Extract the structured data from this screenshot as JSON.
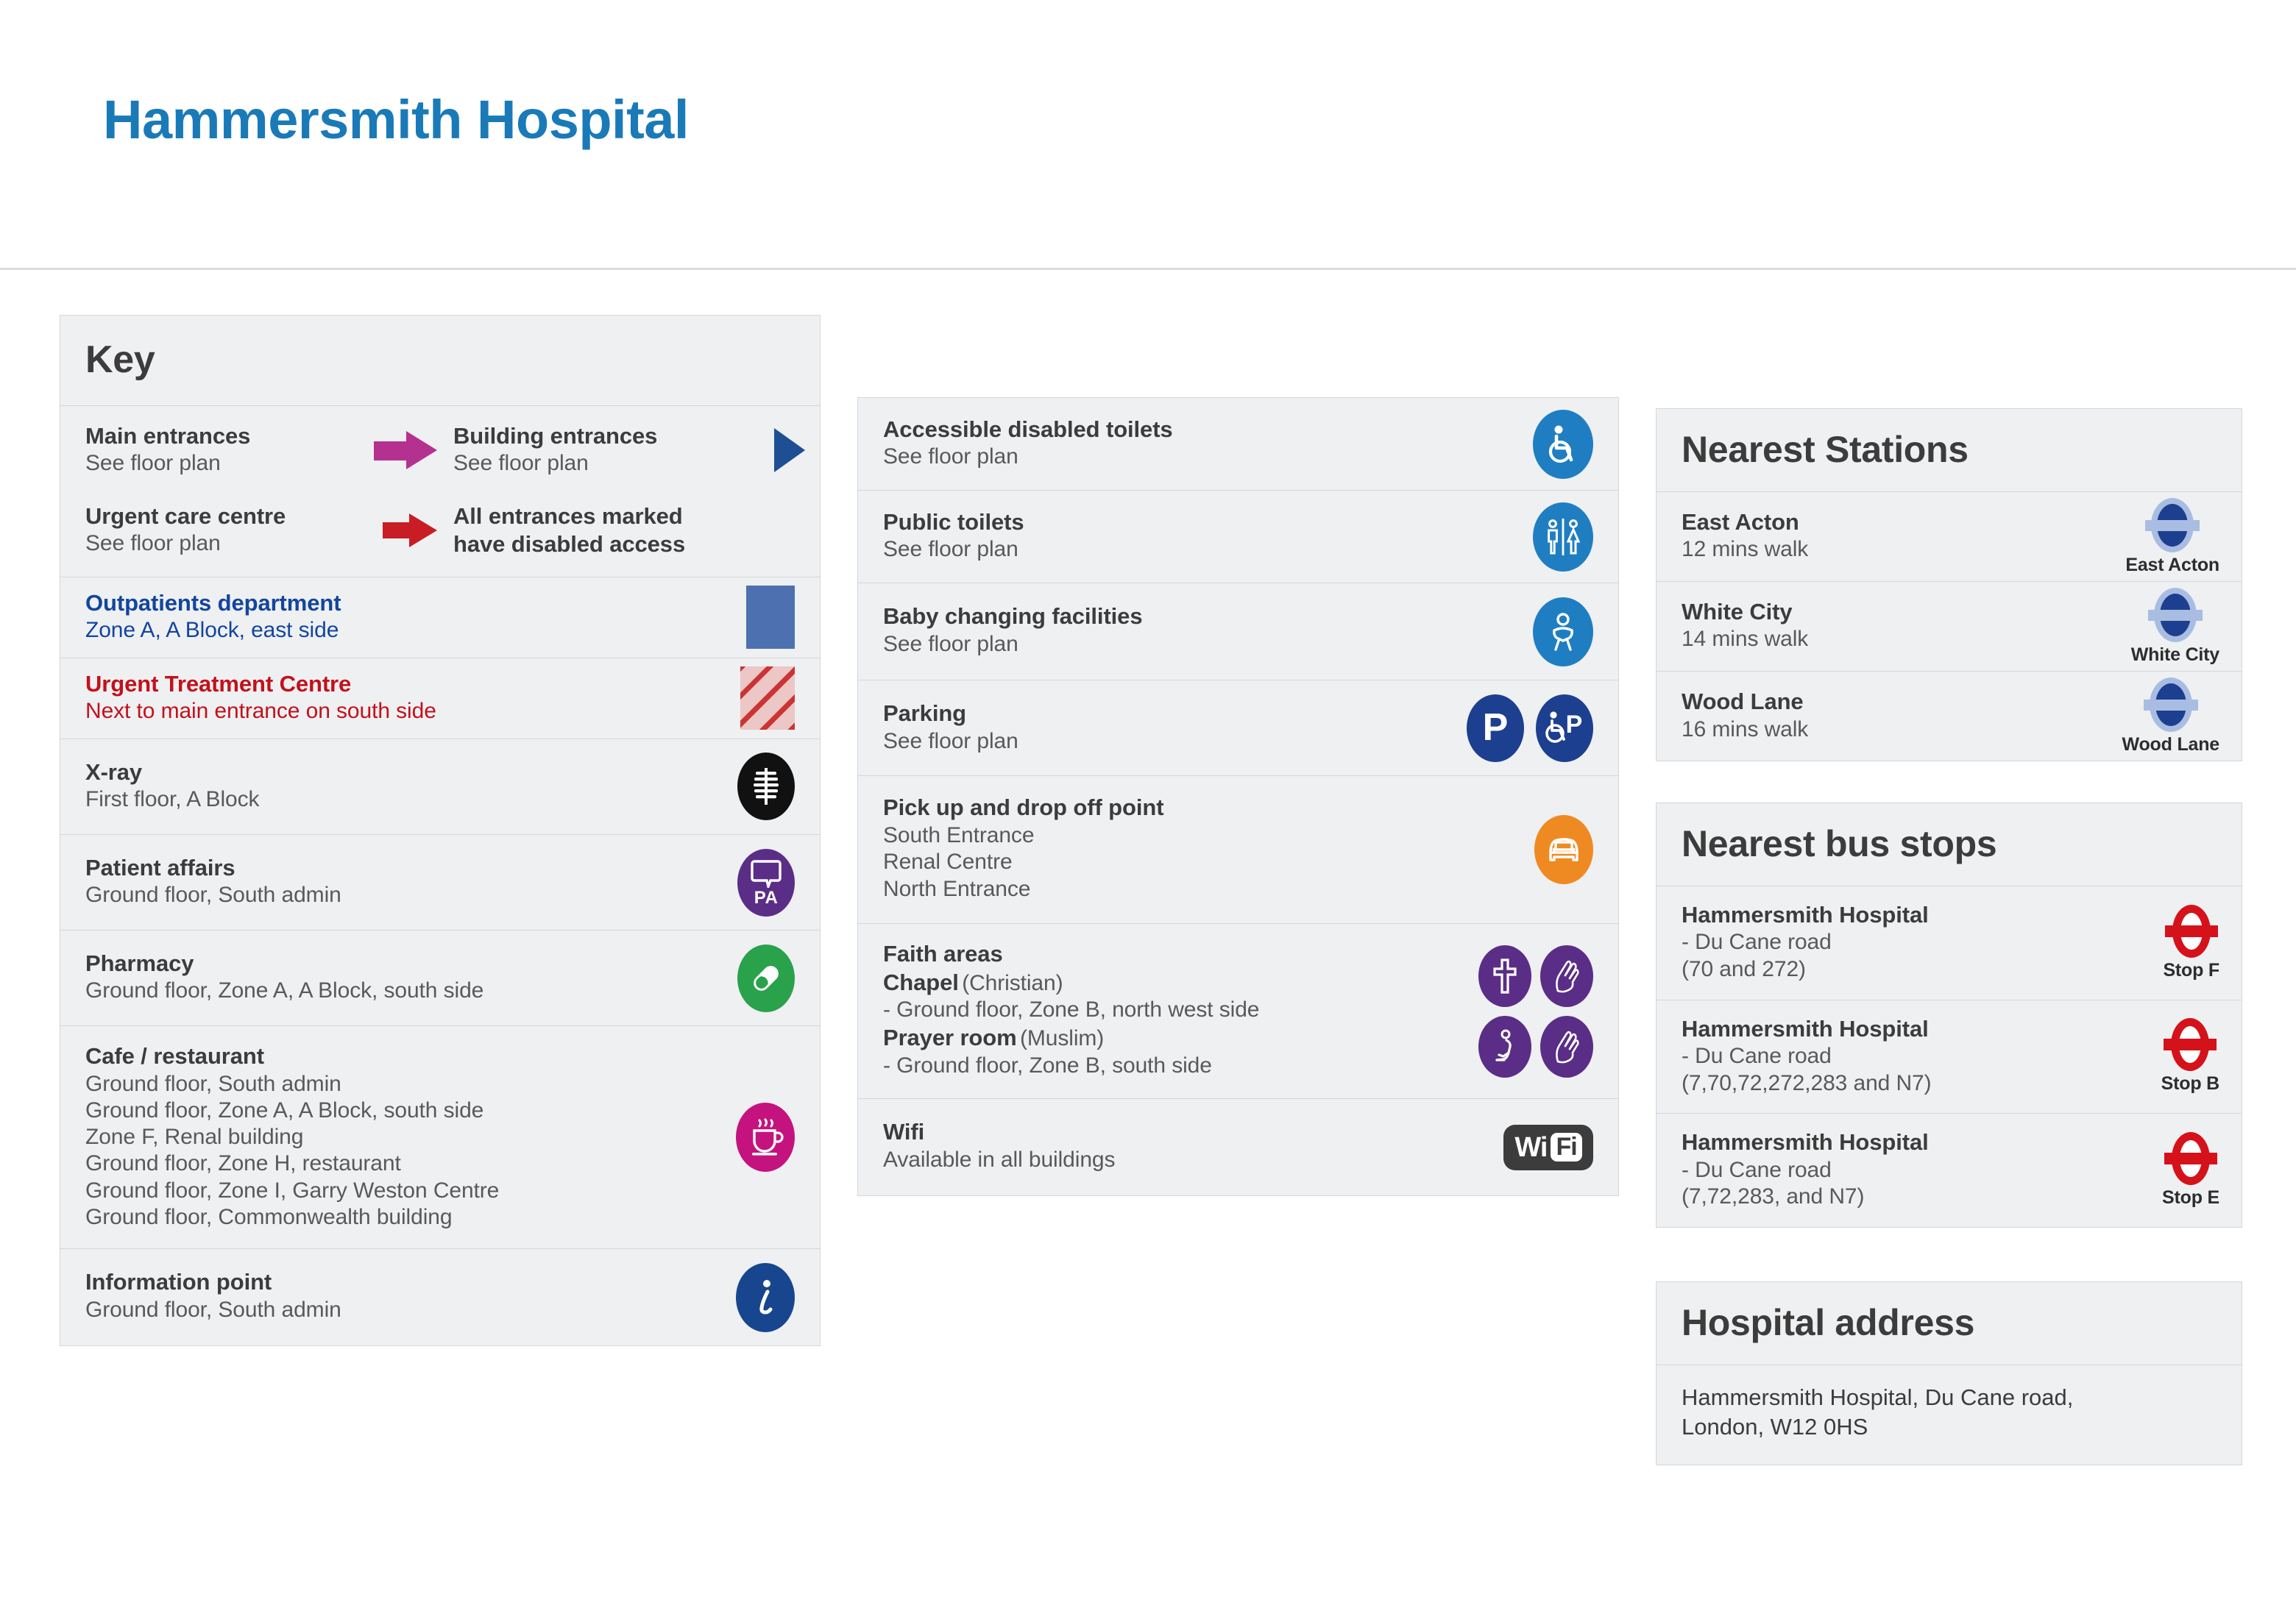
{
  "header": {
    "title": "Hammersmith Hospital"
  },
  "key_panel": {
    "heading": "Key",
    "entrances": {
      "main": {
        "title": "Main entrances",
        "sub": "See floor plan",
        "marker": "magenta-arrow"
      },
      "building": {
        "title": "Building entrances",
        "sub": "See floor plan",
        "marker": "blue-triangle"
      },
      "urgent": {
        "title": "Urgent care centre",
        "sub": "See floor plan",
        "marker": "red-arrow"
      },
      "note_line1": "All entrances marked",
      "note_line2": "have disabled access"
    },
    "rows": [
      {
        "title": "Outpatients department",
        "sub": "Zone A, A Block, east side",
        "marker": "blue-square"
      },
      {
        "title": "Urgent Treatment Centre",
        "sub": "Next to main entrance on south side",
        "marker": "red-hatch-square"
      },
      {
        "title": "X-ray",
        "sub": "First floor, A Block",
        "marker": "xray-icon"
      },
      {
        "title": "Patient affairs",
        "sub": "Ground floor, South admin",
        "marker": "patient-affairs-icon",
        "icon_letters": "PA"
      },
      {
        "title": "Pharmacy",
        "sub": "Ground floor, Zone A, A Block, south side",
        "marker": "pharmacy-pill-icon"
      },
      {
        "title": "Cafe / restaurant",
        "sub_lines": [
          "Ground floor, South admin",
          "Ground floor, Zone A, A Block, south side",
          "Zone F, Renal building",
          "Ground floor, Zone H, restaurant",
          "Ground floor, Zone I, Garry Weston Centre",
          "Ground floor, Commonwealth building"
        ],
        "marker": "coffee-cup-icon"
      },
      {
        "title": "Information point",
        "sub": "Ground floor, South admin",
        "marker": "information-icon"
      }
    ]
  },
  "facilities_panel": {
    "rows": [
      {
        "title": "Accessible disabled toilets",
        "sub": "See floor plan",
        "marker": "wheelchair-icon"
      },
      {
        "title": "Public toilets",
        "sub": "See floor plan",
        "marker": "toilets-icon"
      },
      {
        "title": "Baby changing facilities",
        "sub": "See floor plan",
        "marker": "baby-changing-icon"
      },
      {
        "title": "Parking",
        "sub": "See floor plan",
        "marker": "parking-icon"
      },
      {
        "title": "Pick up and drop off point",
        "sub_lines": [
          "South Entrance",
          "Renal Centre",
          "North Entrance"
        ],
        "marker": "car-icon"
      },
      {
        "title": "Faith areas",
        "chapel_label": "Chapel",
        "chapel_faith": "(Christian)",
        "chapel_location": "- Ground floor, Zone B, north west side",
        "prayer_label": "Prayer room",
        "prayer_faith": "(Muslim)",
        "prayer_location": "- Ground floor, Zone B, south side",
        "marker": "faith-icons"
      },
      {
        "title": "Wifi",
        "sub": "Available in all buildings",
        "marker": "wifi-logo",
        "wifi_wi": "Wi",
        "wifi_fi": "Fi"
      }
    ]
  },
  "stations_panel": {
    "heading": "Nearest Stations",
    "items": [
      {
        "name": "East Acton",
        "walk": "12 mins walk",
        "caption": "East Acton"
      },
      {
        "name": "White City",
        "walk": "14 mins walk",
        "caption": "White City"
      },
      {
        "name": "Wood Lane",
        "walk": "16 mins walk",
        "caption": "Wood Lane"
      }
    ]
  },
  "bus_panel": {
    "heading": "Nearest bus stops",
    "items": [
      {
        "name": "Hammersmith Hospital",
        "road": "- Du Cane road",
        "routes": "(70 and 272)",
        "caption": "Stop F"
      },
      {
        "name": "Hammersmith Hospital",
        "road": "- Du Cane road",
        "routes": "(7,70,72,272,283 and N7)",
        "caption": "Stop B"
      },
      {
        "name": "Hammersmith Hospital",
        "road": "- Du Cane road",
        "routes": "(7,72,283, and N7)",
        "caption": "Stop E"
      }
    ]
  },
  "address_panel": {
    "heading": "Hospital address",
    "line1": "Hammersmith Hospital, Du Cane road,",
    "line2": "London, W12 0HS"
  },
  "colors": {
    "title_blue": "#1a7ab8",
    "panel_bg": "#eff0f2",
    "panel_border": "#d4d6d9",
    "magenta_arrow": "#b5318f",
    "red_arrow": "#c81d25",
    "blue_triangle": "#1f4f93",
    "outpatients_blue": "#12459e",
    "urgent_red": "#c2111b",
    "swatch_blue": "#4d71b0",
    "hatch_red": "#cc3333",
    "purple": "#5a2d87",
    "green": "#2aa14b",
    "magenta_icon": "#c4137f",
    "info_blue": "#17468f",
    "facility_blue": "#1f7ec2",
    "parking_blue": "#1d3f8f",
    "orange": "#ef8a22",
    "tube_navy": "#1d3f8f",
    "tube_light": "#a9bde2",
    "bus_red": "#d5121a",
    "wifi_dark": "#3c3c3c"
  }
}
